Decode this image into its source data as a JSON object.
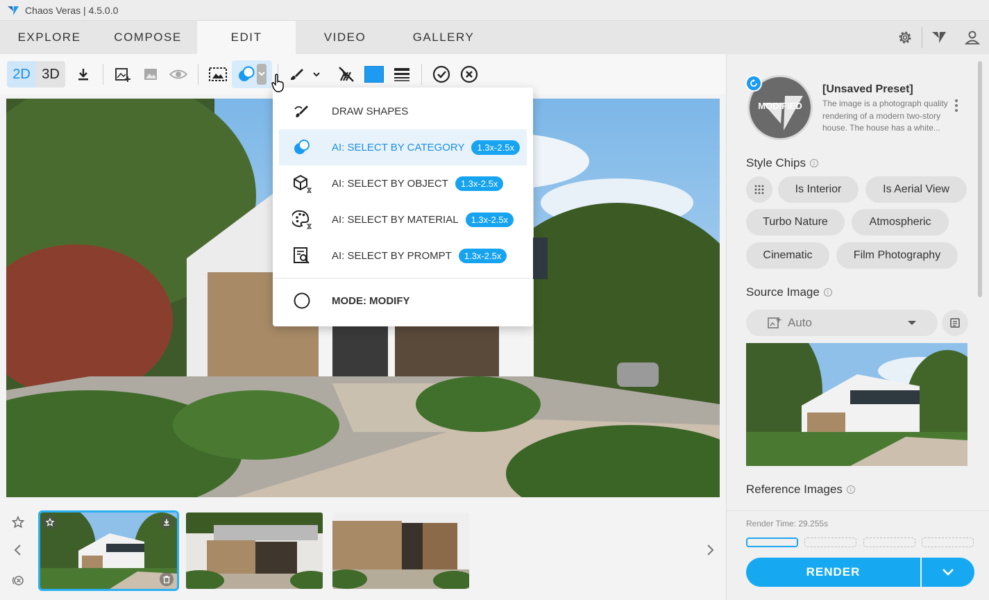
{
  "window": {
    "title": "Chaos Veras | 4.5.0.0"
  },
  "nav": {
    "tabs": [
      {
        "label": "EXPLORE"
      },
      {
        "label": "COMPOSE"
      },
      {
        "label": "EDIT"
      },
      {
        "label": "VIDEO"
      },
      {
        "label": "GALLERY"
      }
    ],
    "active_tab": "EDIT"
  },
  "toolbar": {
    "mode_2d": "2D",
    "mode_3d": "3D",
    "active_mode": "2D",
    "color": "#1e9bf0"
  },
  "dropdown": {
    "items": [
      {
        "label": "DRAW SHAPES",
        "badge": ""
      },
      {
        "label": "AI: SELECT BY CATEGORY",
        "badge": "1.3x-2.5x"
      },
      {
        "label": "AI: SELECT BY OBJECT",
        "badge": "1.3x-2.5x"
      },
      {
        "label": "AI: SELECT BY MATERIAL",
        "badge": "1.3x-2.5x"
      },
      {
        "label": "AI: SELECT BY PROMPT",
        "badge": "1.3x-2.5x"
      }
    ],
    "active_item": "AI: SELECT BY CATEGORY",
    "mode_label": "MODE: MODIFY"
  },
  "preset": {
    "badge": "MODIFIED",
    "title": "[Unsaved Preset]",
    "description": "The image is a photograph quality rendering of a modern two-story house. The house has a white..."
  },
  "style_chips": {
    "label": "Style Chips",
    "chips": [
      "Is Interior",
      "Is Aerial View",
      "Turbo Nature",
      "Atmospheric",
      "Cinematic",
      "Film Photography"
    ]
  },
  "source_image": {
    "label": "Source Image",
    "value": "Auto"
  },
  "reference_images": {
    "label": "Reference Images"
  },
  "render": {
    "time": "Render Time: 29.255s",
    "button_label": "RENDER"
  }
}
